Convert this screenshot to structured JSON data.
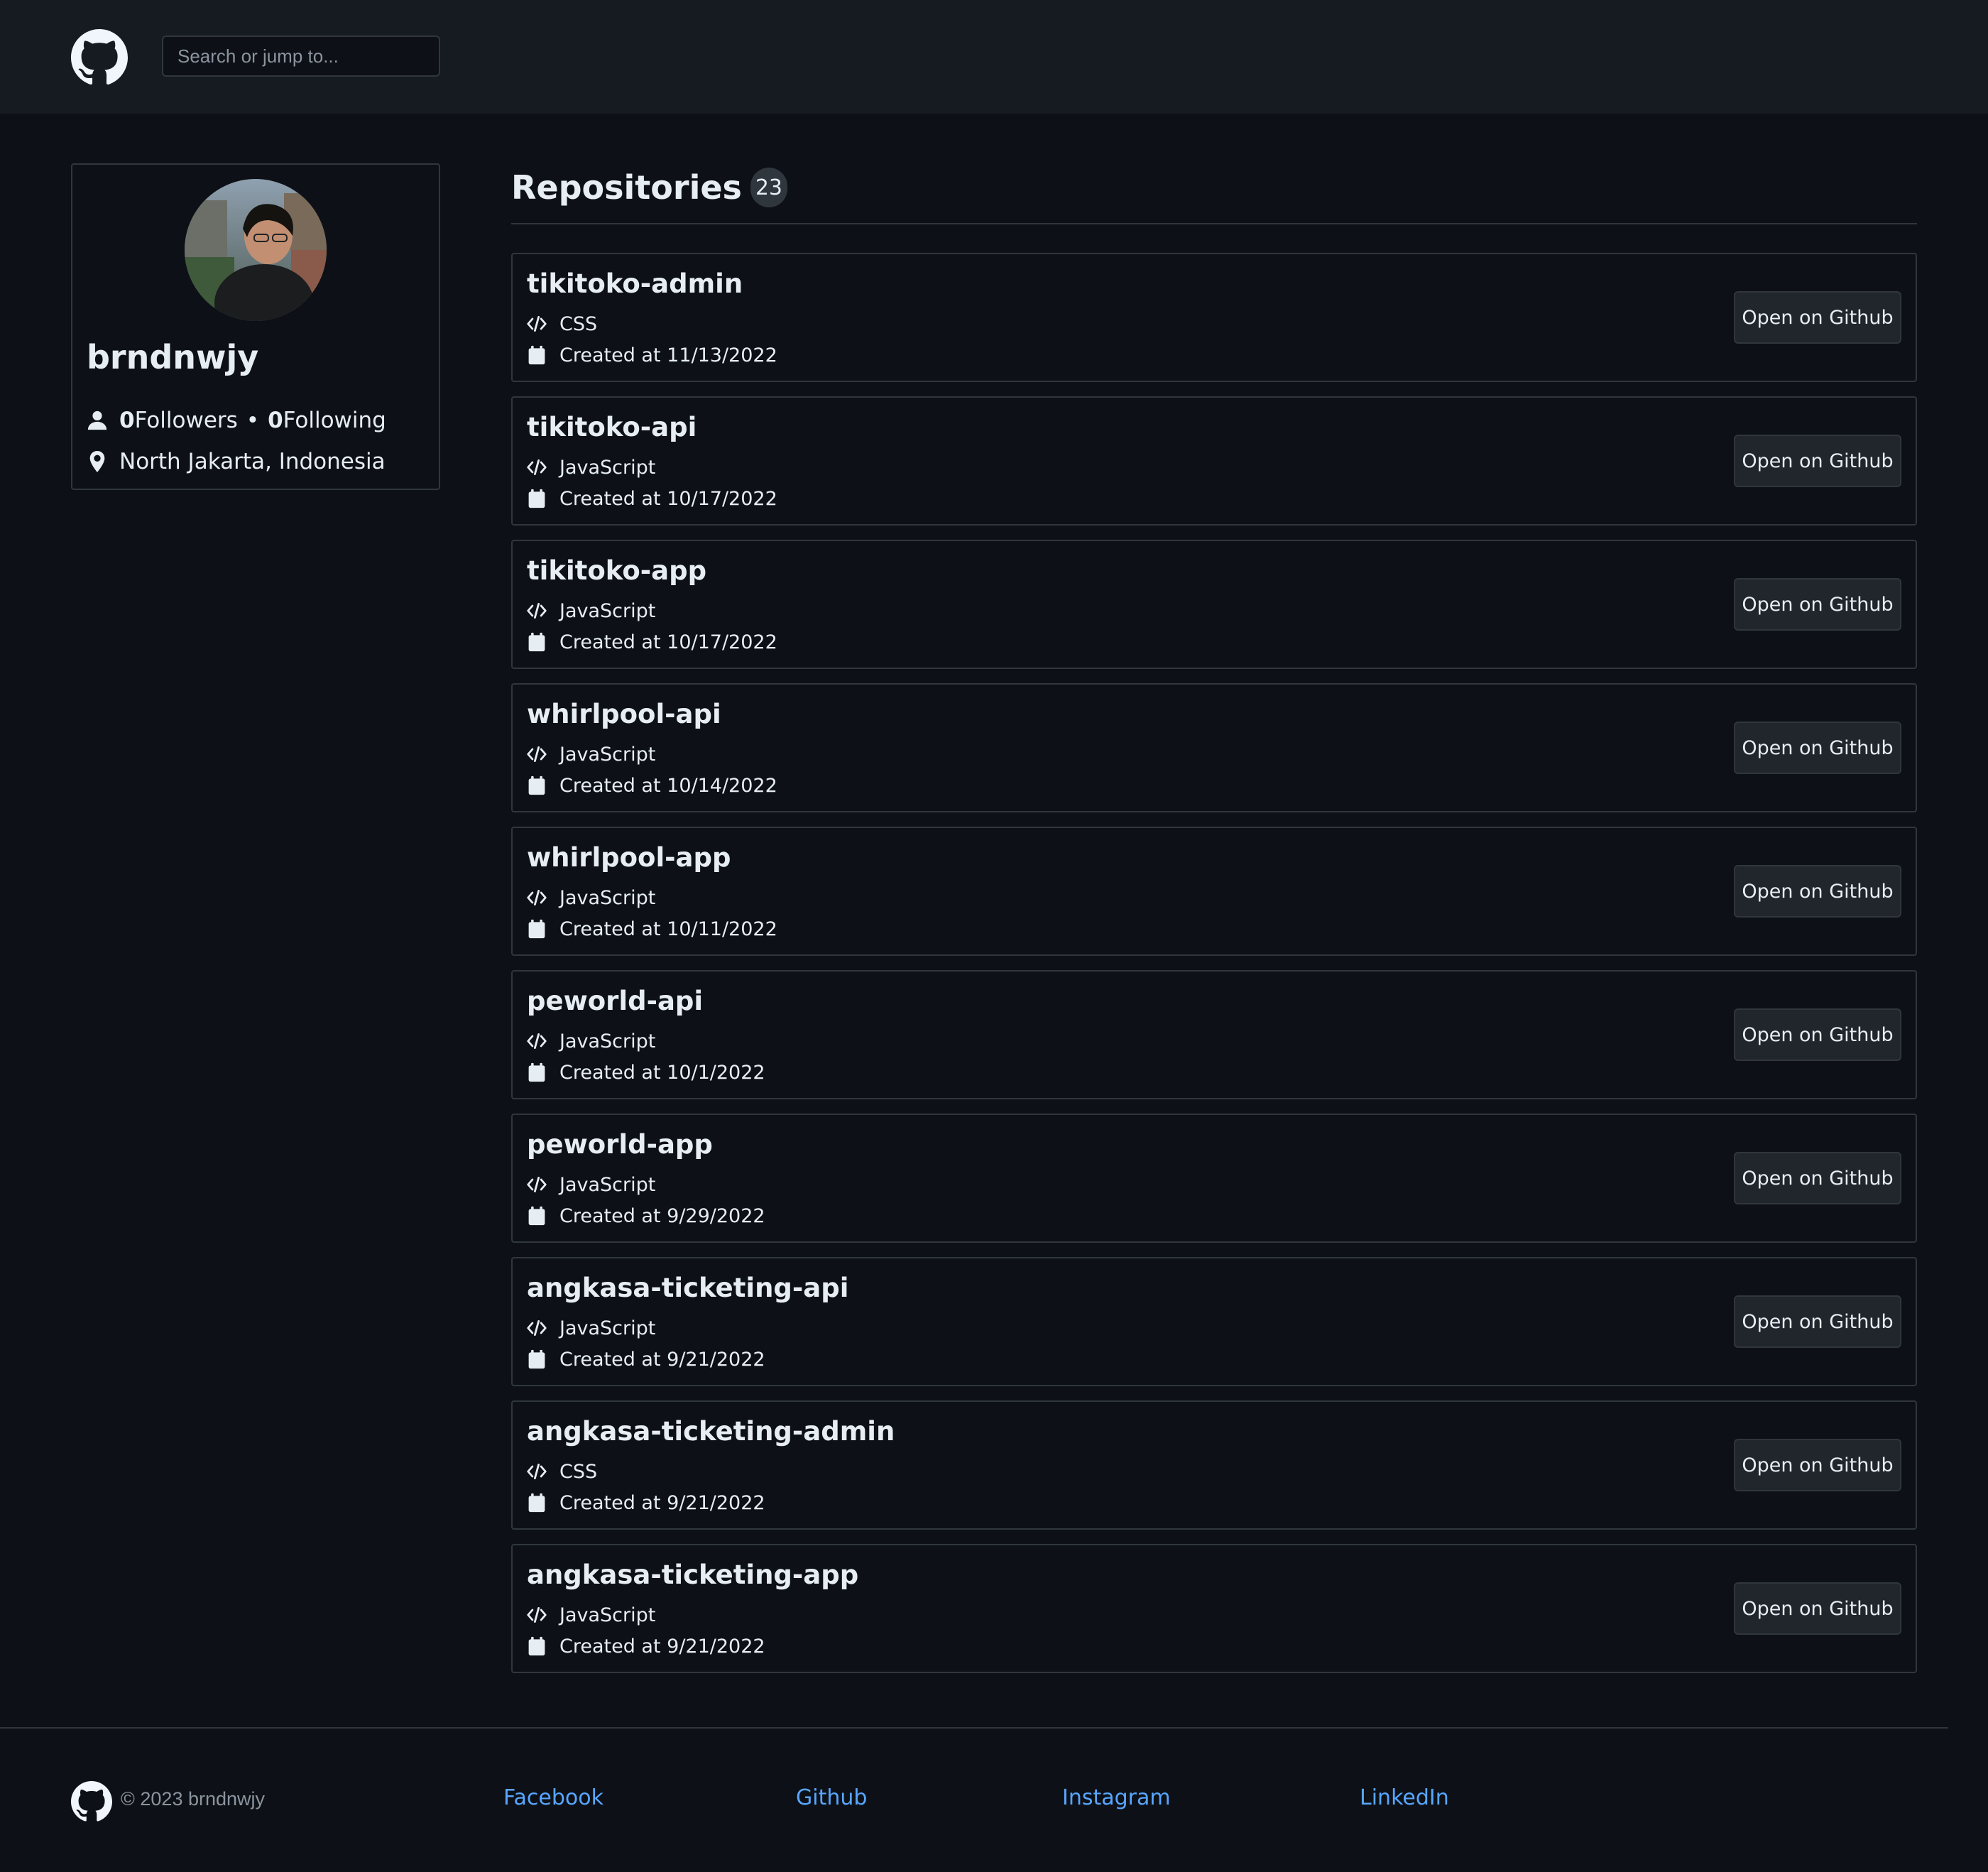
{
  "header": {
    "logo_icon": "github-logo-icon",
    "search_placeholder": "Search or jump to..."
  },
  "profile": {
    "avatar_icon": "user-avatar",
    "username": "brndnwjy",
    "followers_count": "0",
    "followers_label": " Followers",
    "separator": "•",
    "following_count": "0",
    "following_label": " Following",
    "location": "North Jakarta, Indonesia",
    "people_icon": "person-icon",
    "location_icon": "location-pin-icon"
  },
  "repositories": {
    "title": "Repositories",
    "count": "23",
    "button_label": "Open on Github",
    "language_icon": "code-icon",
    "date_icon": "calendar-icon",
    "items": [
      {
        "name": "tikitoko-admin",
        "language": "CSS",
        "created": "Created at 11/13/2022"
      },
      {
        "name": "tikitoko-api",
        "language": "JavaScript",
        "created": "Created at 10/17/2022"
      },
      {
        "name": "tikitoko-app",
        "language": "JavaScript",
        "created": "Created at 10/17/2022"
      },
      {
        "name": "whirlpool-api",
        "language": "JavaScript",
        "created": "Created at 10/14/2022"
      },
      {
        "name": "whirlpool-app",
        "language": "JavaScript",
        "created": "Created at 10/11/2022"
      },
      {
        "name": "peworld-api",
        "language": "JavaScript",
        "created": "Created at 10/1/2022"
      },
      {
        "name": "peworld-app",
        "language": "JavaScript",
        "created": "Created at 9/29/2022"
      },
      {
        "name": "angkasa-ticketing-api",
        "language": "JavaScript",
        "created": "Created at 9/21/2022"
      },
      {
        "name": "angkasa-ticketing-admin",
        "language": "CSS",
        "created": "Created at 9/21/2022"
      },
      {
        "name": "angkasa-ticketing-app",
        "language": "JavaScript",
        "created": "Created at 9/21/2022"
      }
    ]
  },
  "footer": {
    "copyright": "© 2023 brndnwjy",
    "links": [
      "Facebook",
      "Github",
      "Instagram",
      "LinkedIn"
    ]
  },
  "colors": {
    "page_background": "#0d1117",
    "header_background": "#161b22",
    "border": "#30363d",
    "link": "#58a6ff",
    "muted_text": "#8b949e"
  }
}
